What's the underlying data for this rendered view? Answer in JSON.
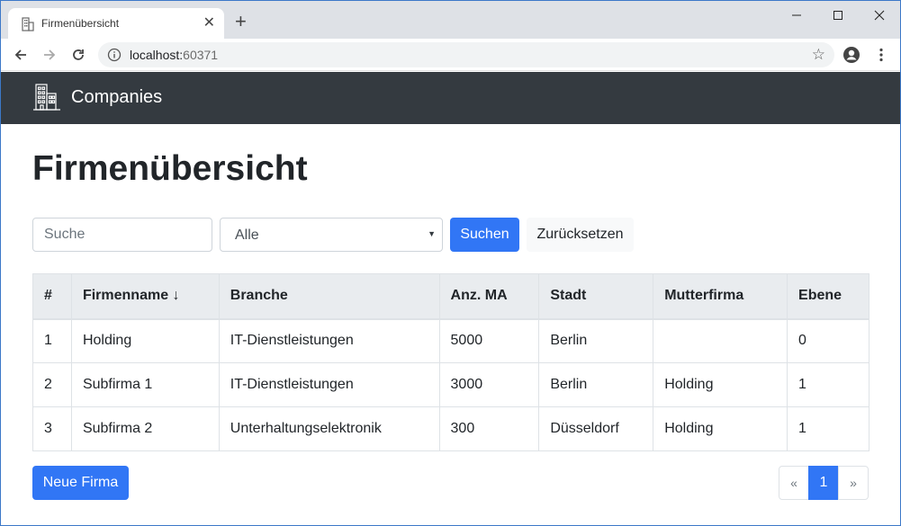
{
  "browser": {
    "tab_title": "Firmenübersicht",
    "new_tab_symbol": "+",
    "close_tab_symbol": "✕",
    "url_host": "localhost:",
    "url_port": "60371",
    "icons": [
      "building-icon",
      "back-arrow-icon",
      "forward-arrow-icon",
      "reload-icon",
      "info-icon",
      "star-icon",
      "account-icon",
      "menu-icon"
    ]
  },
  "navbar": {
    "brand": "Companies",
    "bg_color": "#343a40"
  },
  "page": {
    "title": "Firmenübersicht"
  },
  "filters": {
    "search_placeholder": "Suche",
    "search_value": "",
    "select_value": "Alle",
    "search_button": "Suchen",
    "reset_button": "Zurücksetzen",
    "accent_color": "#3176f5"
  },
  "table": {
    "columns": [
      "#",
      "Firmenname ↓",
      "Branche",
      "Anz. MA",
      "Stadt",
      "Mutterfirma",
      "Ebene"
    ],
    "rows": [
      [
        "1",
        "Holding",
        "IT-Dienstleistungen",
        "5000",
        "Berlin",
        "",
        "0"
      ],
      [
        "2",
        "Subfirma 1",
        "IT-Dienstleistungen",
        "3000",
        "Berlin",
        "Holding",
        "1"
      ],
      [
        "3",
        "Subfirma 2",
        "Unterhaltungselektronik",
        "300",
        "Düsseldorf",
        "Holding",
        "1"
      ]
    ]
  },
  "actions": {
    "new_company_button": "Neue Firma"
  },
  "pagination": {
    "prev": "«",
    "current": "1",
    "next": "»"
  }
}
